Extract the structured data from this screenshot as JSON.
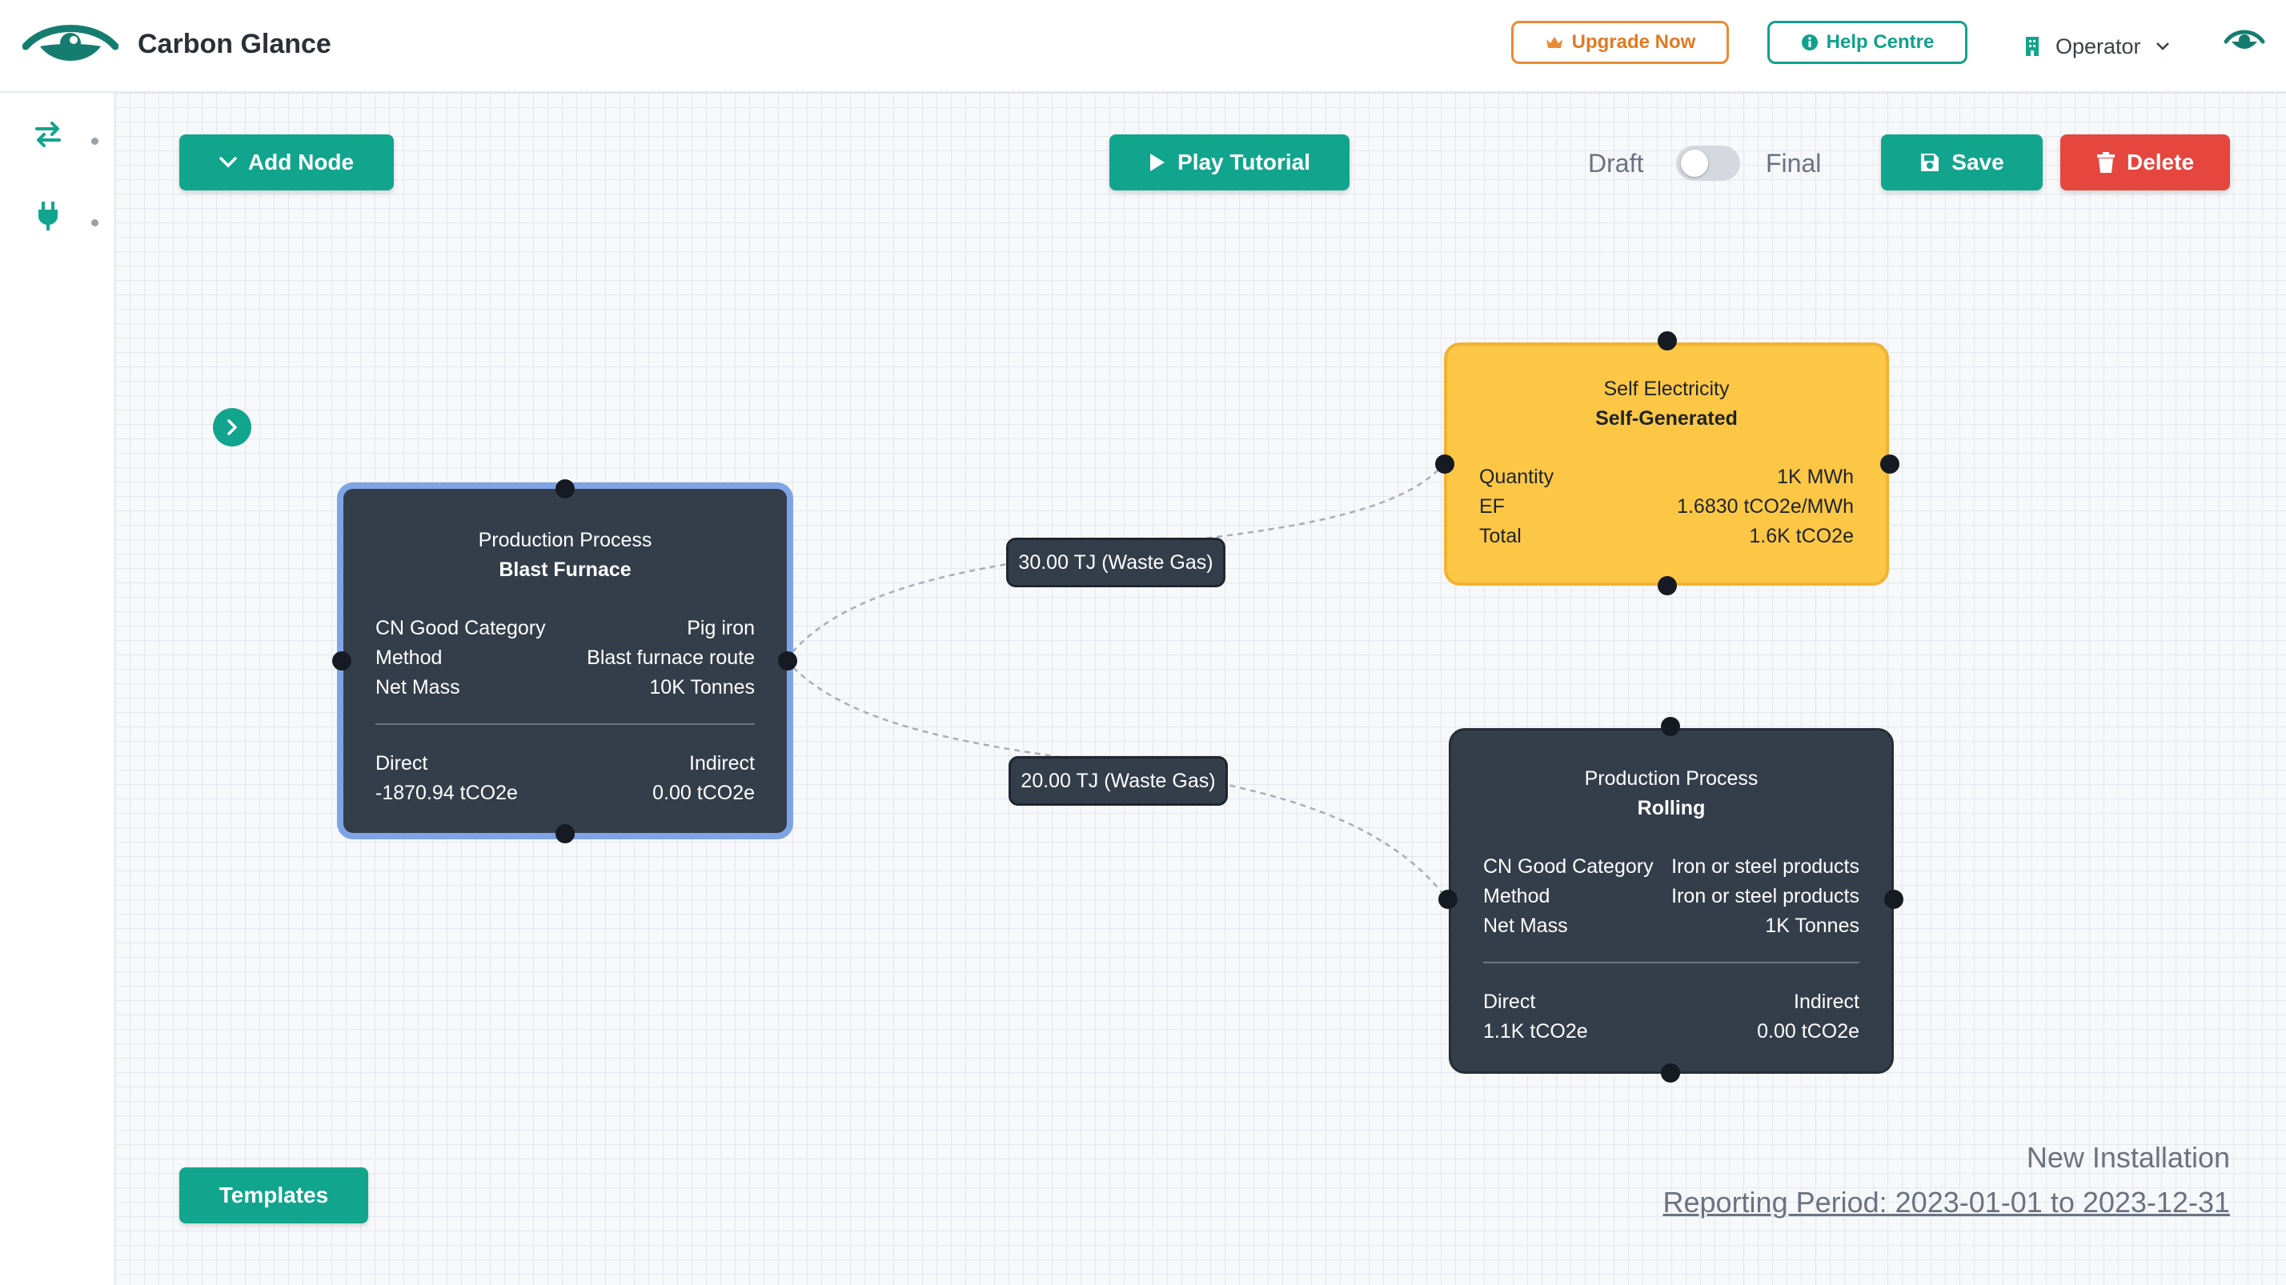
{
  "app": {
    "brand": "Carbon Glance",
    "accent_color": "#12a58d"
  },
  "header": {
    "upgrade_label": "Upgrade Now",
    "help_label": "Help Centre",
    "user_role": "Operator"
  },
  "toolbar": {
    "add_node_label": "Add Node",
    "play_tutorial_label": "Play Tutorial",
    "draft_label": "Draft",
    "final_label": "Final",
    "mode_is_final": false,
    "save_label": "Save",
    "delete_label": "Delete"
  },
  "nodes": {
    "blast_furnace": {
      "type": "Production Process",
      "name": "Blast Furnace",
      "fields": [
        {
          "label": "CN Good Category",
          "value": "Pig iron"
        },
        {
          "label": "Method",
          "value": "Blast furnace route"
        },
        {
          "label": "Net Mass",
          "value": "10K Tonnes"
        }
      ],
      "direct_label": "Direct",
      "direct_value": "-1870.94 tCO2e",
      "indirect_label": "Indirect",
      "indirect_value": "0.00 tCO2e"
    },
    "self_electricity": {
      "type": "Self Electricity",
      "name": "Self-Generated",
      "fields": [
        {
          "label": "Quantity",
          "value": "1K MWh"
        },
        {
          "label": "EF",
          "value": "1.6830 tCO2e/MWh"
        },
        {
          "label": "Total",
          "value": "1.6K tCO2e"
        }
      ]
    },
    "rolling": {
      "type": "Production Process",
      "name": "Rolling",
      "fields": [
        {
          "label": "CN Good Category",
          "value": "Iron or steel products"
        },
        {
          "label": "Method",
          "value": "Iron or steel products"
        },
        {
          "label": "Net Mass",
          "value": "1K Tonnes"
        }
      ],
      "direct_label": "Direct",
      "direct_value": "1.1K tCO2e",
      "indirect_label": "Indirect",
      "indirect_value": "0.00 tCO2e"
    }
  },
  "edges": {
    "to_electricity": "30.00 TJ (Waste Gas)",
    "to_rolling": "20.00 TJ (Waste Gas)"
  },
  "footer": {
    "templates_label": "Templates",
    "installation": "New Installation",
    "reporting_period": "Reporting Period: 2023-01-01 to 2023-12-31"
  }
}
